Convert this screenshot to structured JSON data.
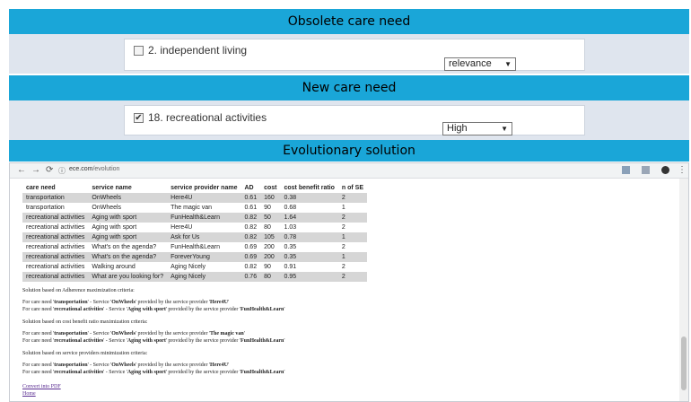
{
  "sections": {
    "obsolete_title": "Obsolete care need",
    "new_title": "New care need",
    "evolution_title": "Evolutionary solution"
  },
  "obsolete": {
    "item_label": "2. independent living",
    "checked": false,
    "select_value": "relevance"
  },
  "new_need": {
    "item_label": "18. recreational activities",
    "checked": true,
    "select_value": "High"
  },
  "browser": {
    "url_host": "ece.com",
    "url_path": "/evolution",
    "icons": [
      "back-icon",
      "forward-icon",
      "reload-icon",
      "info-icon"
    ]
  },
  "table": {
    "headers": [
      "care need",
      "service name",
      "service provider name",
      "AD",
      "cost",
      "cost benefit ratio",
      "n of SE"
    ],
    "rows": [
      [
        "transportation",
        "OnWheels",
        "Here4U",
        "0.61",
        "160",
        "0.38",
        "2"
      ],
      [
        "transportation",
        "OnWheels",
        "The magic van",
        "0.61",
        "90",
        "0.68",
        "1"
      ],
      [
        "recreational activities",
        "Aging with sport",
        "FunHealth&Learn",
        "0.82",
        "50",
        "1.64",
        "2"
      ],
      [
        "recreational activities",
        "Aging with sport",
        "Here4U",
        "0.82",
        "80",
        "1.03",
        "2"
      ],
      [
        "recreational activities",
        "Aging with sport",
        "Ask for Us",
        "0.82",
        "105",
        "0.78",
        "1"
      ],
      [
        "recreational activities",
        "What's on the agenda?",
        "FunHealth&Learn",
        "0.69",
        "200",
        "0.35",
        "2"
      ],
      [
        "recreational activities",
        "What's on the agenda?",
        "ForeverYoung",
        "0.69",
        "200",
        "0.35",
        "1"
      ],
      [
        "recreational activities",
        "Walking around",
        "Aging Nicely",
        "0.82",
        "90",
        "0.91",
        "2"
      ],
      [
        "recreational activities",
        "What are you looking for?",
        "Aging Nicely",
        "0.76",
        "80",
        "0.95",
        "2"
      ]
    ]
  },
  "solutions": {
    "adherence_title": "Solution based on Adherence maximization criteria:",
    "adherence_1": {
      "pre": "For care need '",
      "need": "transportation",
      "mid1": "' - Service '",
      "service": "OnWheels",
      "mid2": "' provided by the service provider '",
      "provider": "Here4U",
      "post": "'"
    },
    "adherence_2": {
      "pre": "For care need '",
      "need": "recreational activities",
      "mid1": "' - Service '",
      "service": "Aging with sport",
      "mid2": "' provided by the service provider '",
      "provider": "FunHealth&Learn",
      "post": "'"
    },
    "cost_title": "Solution based on cost benefit ratio maximization criteria:",
    "cost_1": {
      "pre": "For care need '",
      "need": "transportation",
      "mid1": "' - Service '",
      "service": "OnWheels",
      "mid2": "' provided by the service provider '",
      "provider": "The magic van",
      "post": "'"
    },
    "cost_2": {
      "pre": "For care need '",
      "need": "recreational activities",
      "mid1": "' - Service '",
      "service": "Aging with sport",
      "mid2": "' provided by the service provider '",
      "provider": "FunHealth&Learn",
      "post": "'"
    },
    "prov_title": "Solution based on service providers minimization criteria:",
    "prov_1": {
      "pre": "For care need '",
      "need": "transportation",
      "mid1": "' - Service '",
      "service": "OnWheels",
      "mid2": "' provided by the service provider '",
      "provider": "Here4U",
      "post": "'"
    },
    "prov_2": {
      "pre": "For care need '",
      "need": "recreational activities",
      "mid1": "' - Service '",
      "service": "Aging with sport",
      "mid2": "' provided by the service provider '",
      "provider": "FunHealth&Learn",
      "post": "'"
    }
  },
  "links": {
    "pdf": "Convert into PDF",
    "home": "Home"
  },
  "colors": {
    "band": "#1aa6d8",
    "row_bg": "#dfe5ee",
    "table_stripe": "#d6d6d6",
    "link": "#5a2d91"
  }
}
